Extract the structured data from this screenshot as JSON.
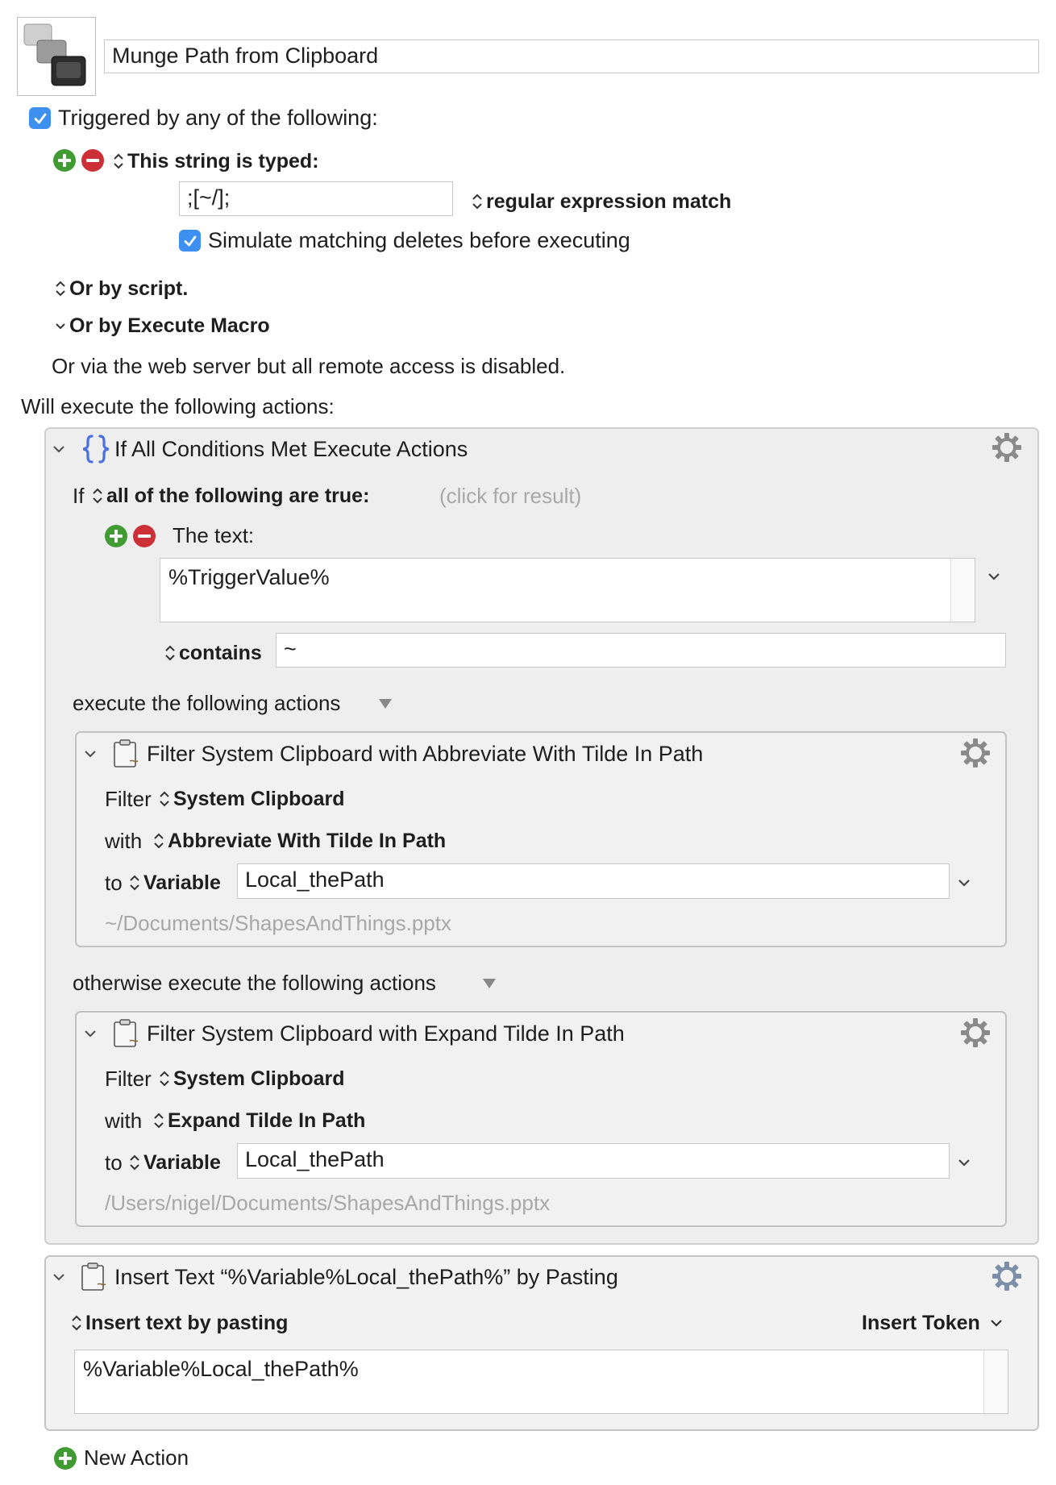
{
  "macro": {
    "name": "Munge Path from Clipboard",
    "icon": "keyboard-maestro-macro-icon"
  },
  "triggers": {
    "triggered_by_label": "Triggered by any of the following:",
    "string_trigger": {
      "label": "This string is typed:",
      "value": ";[~/];",
      "match_mode": "regular expression match",
      "simulate_deletes_label": "Simulate matching deletes before executing"
    },
    "or_by_script": "Or by script.",
    "or_by_execute_macro": "Or by Execute Macro",
    "web_server_note": "Or via the web server but all remote access is disabled."
  },
  "actions_header": "Will execute the following actions:",
  "if_action": {
    "title": "If All Conditions Met Execute Actions",
    "if_label": "If",
    "condition_mode": "all of the following are true:",
    "click_for_result": "(click for result)",
    "condition_label": "The text:",
    "condition_text": "%TriggerValue%",
    "operator": "contains",
    "operand": "~",
    "then_label": "execute the following actions",
    "else_label": "otherwise execute the following actions"
  },
  "filter_abbrev": {
    "title": "Filter System Clipboard with Abbreviate With Tilde In Path",
    "filter_label": "Filter",
    "filter_source": "System Clipboard",
    "with_label": "with",
    "with_value": "Abbreviate With Tilde In Path",
    "to_label": "to",
    "to_type": "Variable",
    "variable": "Local_thePath",
    "preview": "~/Documents/ShapesAndThings.pptx"
  },
  "filter_expand": {
    "title": "Filter System Clipboard with Expand Tilde In Path",
    "filter_label": "Filter",
    "filter_source": "System Clipboard",
    "with_label": "with",
    "with_value": "Expand Tilde In Path",
    "to_label": "to",
    "to_type": "Variable",
    "variable": "Local_thePath",
    "preview": "/Users/nigel/Documents/ShapesAndThings.pptx"
  },
  "insert_action": {
    "title": "Insert Text “%Variable%Local_thePath%” by Pasting",
    "mode": "Insert text by pasting",
    "token_button": "Insert Token",
    "text": "%Variable%Local_thePath%"
  },
  "new_action_label": "New Action",
  "colors": {
    "checkbox_blue": "#3d8ff0",
    "add_green": "#3f9b32",
    "remove_red": "#cc2f36",
    "braces_blue": "#4a6fe0"
  }
}
